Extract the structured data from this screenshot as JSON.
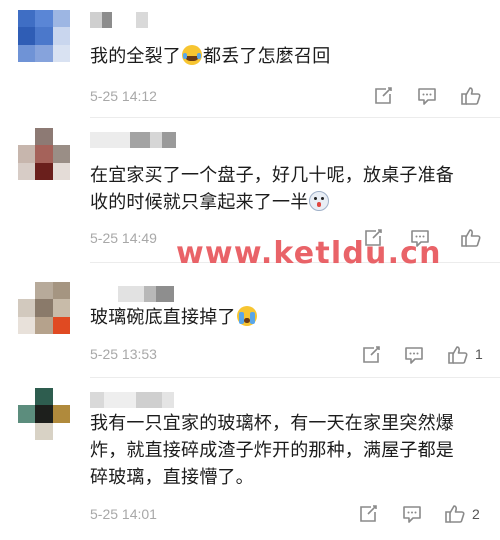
{
  "comments": [
    {
      "text_parts": [
        "我的全裂了",
        "都丢了怎麼召回"
      ],
      "emoji_after_first": "laughing-tears-emoji",
      "time": "5-25 14:12",
      "likes": ""
    },
    {
      "text_line1": "在宜家买了一个盘子，好几十呢，放桌子准备",
      "text_line2": "收的时候就只拿起来了一半",
      "emoji": "dog-face-emoji",
      "time": "5-25 14:49",
      "likes": ""
    },
    {
      "text": "玻璃碗底直接掉了",
      "emoji": "crying-emoji",
      "time": "5-25 13:53",
      "likes": "1"
    },
    {
      "text_line1": "我有一只宜家的玻璃杯，有一天在家里突然爆",
      "text_line2": "炸，就直接碎成渣子炸开的那种，满屋子都是",
      "text_line3": "碎玻璃，直接懵了。",
      "time": "5-25 14:01",
      "likes": "2"
    }
  ],
  "watermark": "www.ketldu.cn",
  "colors": {
    "watermark": "#e8565c",
    "time": "#a8a8a8",
    "icon": "#8a8a8a"
  }
}
